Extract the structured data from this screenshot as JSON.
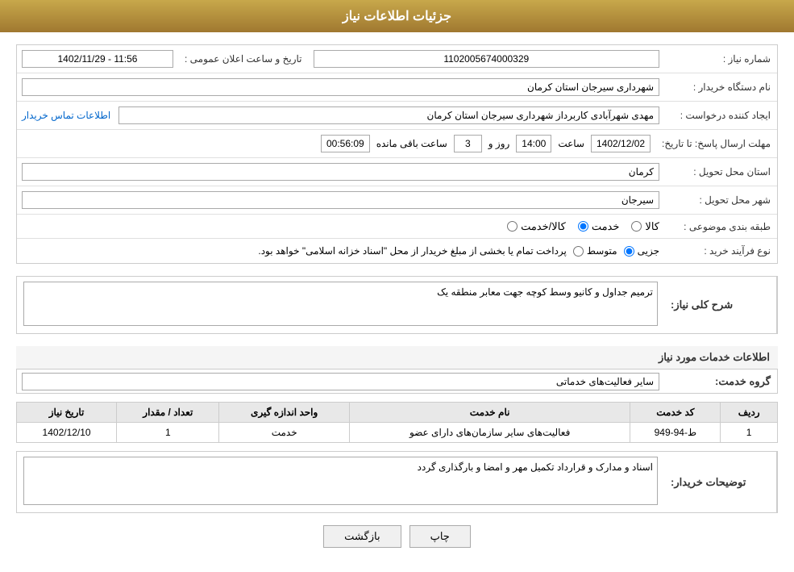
{
  "header": {
    "title": "جزئیات اطلاعات نیاز"
  },
  "fields": {
    "need_number_label": "شماره نیاز :",
    "need_number_value": "1102005674000329",
    "announce_datetime_label": "تاریخ و ساعت اعلان عمومی :",
    "announce_datetime_value": "1402/11/29 - 11:56",
    "buyer_org_label": "نام دستگاه خریدار :",
    "buyer_org_value": "شهرداری سیرجان استان کرمان",
    "creator_label": "ایجاد کننده درخواست :",
    "creator_value": "مهدی شهرآبادی کاربرداز شهرداری سیرجان استان کرمان",
    "contact_info_link": "اطلاعات تماس خریدار",
    "reply_deadline_label": "مهلت ارسال پاسخ: تا تاریخ:",
    "reply_date_value": "1402/12/02",
    "reply_time_label": "ساعت",
    "reply_time_value": "14:00",
    "days_label": "روز و",
    "days_value": "3",
    "remaining_label": "ساعت باقی مانده",
    "remaining_time": "00:56:09",
    "delivery_province_label": "استان محل تحویل :",
    "delivery_province_value": "کرمان",
    "delivery_city_label": "شهر محل تحویل :",
    "delivery_city_value": "سیرجان",
    "category_label": "طبقه بندی موضوعی :",
    "category_options": [
      "کالا",
      "خدمت",
      "کالا/خدمت"
    ],
    "category_selected": "خدمت",
    "purchase_type_label": "نوع فرآیند خرید :",
    "purchase_type_options": [
      "جزیی",
      "متوسط"
    ],
    "purchase_type_note": "پرداخت تمام یا بخشی از مبلغ خریدار از محل \"اسناد خزانه اسلامی\" خواهد بود.",
    "need_description_label": "شرح کلی نیاز:",
    "need_description_value": "ترمیم جداول و کانیو وسط کوچه جهت معابر منطقه یک",
    "services_section_label": "اطلاعات خدمات مورد نیاز",
    "service_group_label": "گروه خدمت:",
    "service_group_value": "سایر فعالیت‌های خدماتی",
    "table": {
      "headers": [
        "ردیف",
        "کد خدمت",
        "نام خدمت",
        "واحد اندازه گیری",
        "تعداد / مقدار",
        "تاریخ نیاز"
      ],
      "rows": [
        {
          "row": "1",
          "code": "ط-94-949",
          "name": "فعالیت‌های سایر سازمان‌های دارای عضو",
          "unit": "خدمت",
          "quantity": "1",
          "date": "1402/12/10"
        }
      ]
    },
    "buyer_notes_label": "توضیحات خریدار:",
    "buyer_notes_value": "اسناد و مدارک و قرارداد تکمیل مهر و امضا و بارگذاری گردد"
  },
  "buttons": {
    "print_label": "چاپ",
    "back_label": "بازگشت"
  }
}
